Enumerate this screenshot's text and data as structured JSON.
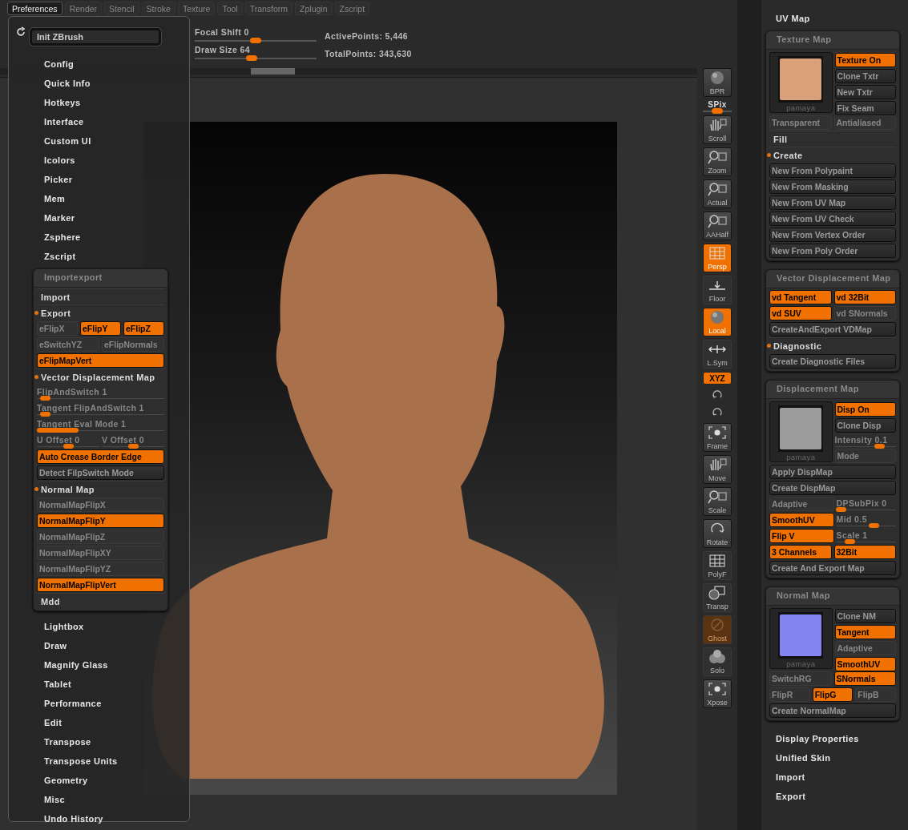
{
  "menu_bar": [
    {
      "label": "Preferences",
      "selected": true
    },
    {
      "label": "Render",
      "selected": false
    },
    {
      "label": "Stencil",
      "selected": false
    },
    {
      "label": "Stroke",
      "selected": false
    },
    {
      "label": "Texture",
      "selected": false
    },
    {
      "label": "Tool",
      "selected": false
    },
    {
      "label": "Transform",
      "selected": false
    },
    {
      "label": "Zplugin",
      "selected": false
    },
    {
      "label": "Zscript",
      "selected": false
    }
  ],
  "toolbar": {
    "focal_shift": {
      "label": "Focal Shift",
      "value": "0",
      "level": 0.5
    },
    "draw_size": {
      "label": "Draw Size",
      "value": "64",
      "level": 0.47
    },
    "stats": [
      {
        "label": "ActivePoints:",
        "value": "5,446"
      },
      {
        "label": "TotalPoints:",
        "value": "343,630"
      }
    ]
  },
  "columns": [
    {
      "kind": "menu",
      "init_button": "Init ZBrush",
      "items": [
        {
          "kind": "item",
          "label": "Config"
        },
        {
          "kind": "item",
          "label": "Quick Info"
        },
        {
          "kind": "item",
          "label": "Hotkeys"
        },
        {
          "kind": "item",
          "label": "Interface"
        },
        {
          "kind": "item",
          "label": "Custom UI"
        },
        {
          "kind": "item",
          "label": "Icolors"
        },
        {
          "kind": "item",
          "label": "Picker"
        },
        {
          "kind": "item",
          "label": "Mem"
        },
        {
          "kind": "item",
          "label": "Marker"
        },
        {
          "kind": "item",
          "label": "Zsphere"
        },
        {
          "kind": "item",
          "label": "Zscript"
        },
        {
          "kind": "panel",
          "title": "Importexport",
          "rows": [
            {
              "kind": "section",
              "label": "Import",
              "expanded": false
            },
            {
              "kind": "section",
              "label": "Export",
              "expanded": true
            },
            {
              "kind": "buttons",
              "items": [
                {
                  "kind": "toggle",
                  "label": "eFlipX",
                  "on": false
                },
                {
                  "kind": "toggle",
                  "label": "eFlipY",
                  "on": true
                },
                {
                  "kind": "toggle",
                  "label": "eFlipZ",
                  "on": true
                }
              ]
            },
            {
              "kind": "buttons",
              "items": [
                {
                  "kind": "toggle",
                  "label": "eSwitchYZ",
                  "on": false
                },
                {
                  "kind": "toggle",
                  "label": "eFlipNormals",
                  "on": false
                }
              ]
            },
            {
              "kind": "buttons",
              "items": [
                {
                  "kind": "toggle",
                  "label": "eFlipMapVert",
                  "on": true
                }
              ]
            },
            {
              "kind": "section",
              "label": "Vector Displacement Map",
              "expanded": true
            },
            {
              "kind": "buttons",
              "items": [
                {
                  "kind": "slider",
                  "label": "FlipAndSwitch",
                  "value": "1",
                  "level": 0.06
                }
              ]
            },
            {
              "kind": "buttons",
              "items": [
                {
                  "kind": "slider",
                  "label": "Tangent FlipAndSwitch",
                  "value": "1",
                  "level": 0.06
                }
              ]
            },
            {
              "kind": "buttons",
              "items": [
                {
                  "kind": "slider",
                  "label": "Tangent Eval Mode",
                  "value": "1",
                  "level": 0.33
                }
              ]
            },
            {
              "kind": "buttons",
              "items": [
                {
                  "kind": "slider",
                  "label": "U Offset",
                  "value": "0",
                  "level": 0.5
                },
                {
                  "kind": "slider",
                  "label": "V Offset",
                  "value": "0",
                  "level": 0.5
                }
              ]
            },
            {
              "kind": "buttons",
              "items": [
                {
                  "kind": "toggle",
                  "label": "Auto Crease Border Edge",
                  "on": true
                }
              ]
            },
            {
              "kind": "buttons",
              "items": [
                {
                  "kind": "action",
                  "label": "Detect FilpSwitch Mode"
                }
              ]
            },
            {
              "kind": "section",
              "label": "Normal Map",
              "expanded": true
            },
            {
              "kind": "buttons",
              "items": [
                {
                  "kind": "toggle",
                  "label": "NormalMapFlipX",
                  "on": false
                }
              ]
            },
            {
              "kind": "buttons",
              "items": [
                {
                  "kind": "toggle",
                  "label": "NormalMapFlipY",
                  "on": true
                }
              ]
            },
            {
              "kind": "buttons",
              "items": [
                {
                  "kind": "toggle",
                  "label": "NormalMapFlipZ",
                  "on": false
                }
              ]
            },
            {
              "kind": "buttons",
              "items": [
                {
                  "kind": "toggle",
                  "label": "NormalMapFlipXY",
                  "on": false
                }
              ]
            },
            {
              "kind": "buttons",
              "items": [
                {
                  "kind": "toggle",
                  "label": "NormalMapFlipYZ",
                  "on": false
                }
              ]
            },
            {
              "kind": "buttons",
              "items": [
                {
                  "kind": "toggle",
                  "label": "NormalMapFlipVert",
                  "on": true
                }
              ]
            },
            {
              "kind": "section",
              "label": "Mdd",
              "expanded": false
            }
          ]
        },
        {
          "kind": "item",
          "label": "Lightbox"
        },
        {
          "kind": "item",
          "label": "Draw"
        },
        {
          "kind": "item",
          "label": "Magnify Glass"
        },
        {
          "kind": "item",
          "label": "Tablet"
        },
        {
          "kind": "item",
          "label": "Performance"
        },
        {
          "kind": "item",
          "label": "Edit"
        },
        {
          "kind": "item",
          "label": "Transpose"
        },
        {
          "kind": "item",
          "label": "Transpose Units"
        },
        {
          "kind": "item",
          "label": "Geometry"
        },
        {
          "kind": "item",
          "label": "Misc"
        },
        {
          "kind": "item",
          "label": "Undo History"
        }
      ]
    },
    {
      "kind": "tray",
      "items": [
        {
          "kind": "item",
          "label": "UV Map"
        },
        {
          "kind": "panel",
          "title": "Texture Map",
          "rows": [
            {
              "kind": "thumb",
              "caption": "pamaya",
              "color": "#d9a07a",
              "items": [
                {
                  "kind": "toggle",
                  "label": "Texture On",
                  "on": true
                },
                {
                  "kind": "action",
                  "label": "Clone Txtr"
                },
                {
                  "kind": "action",
                  "label": "New Txtr"
                },
                {
                  "kind": "action",
                  "label": "Fix Seam"
                }
              ]
            },
            {
              "kind": "buttons",
              "items": [
                {
                  "kind": "toggle",
                  "label": "Transparent",
                  "on": false
                },
                {
                  "kind": "toggle",
                  "label": "Antialiased",
                  "on": false
                }
              ]
            },
            {
              "kind": "section",
              "label": "Fill",
              "expanded": false
            },
            {
              "kind": "section",
              "label": "Create",
              "expanded": true
            },
            {
              "kind": "buttons",
              "items": [
                {
                  "kind": "action",
                  "label": "New From Polypaint"
                }
              ]
            },
            {
              "kind": "buttons",
              "items": [
                {
                  "kind": "action",
                  "label": "New From Masking"
                }
              ]
            },
            {
              "kind": "buttons",
              "items": [
                {
                  "kind": "action",
                  "label": "New From UV Map"
                }
              ]
            },
            {
              "kind": "buttons",
              "items": [
                {
                  "kind": "action",
                  "label": "New From UV Check"
                }
              ]
            },
            {
              "kind": "buttons",
              "items": [
                {
                  "kind": "action",
                  "label": "New From Vertex Order"
                }
              ]
            },
            {
              "kind": "buttons",
              "items": [
                {
                  "kind": "action",
                  "label": "New From Poly Order"
                }
              ]
            }
          ]
        },
        {
          "kind": "panel",
          "title": "Vector Displacement Map",
          "rows": [
            {
              "kind": "buttons",
              "items": [
                {
                  "kind": "toggle",
                  "label": "vd Tangent",
                  "on": true
                },
                {
                  "kind": "toggle",
                  "label": "vd 32Bit",
                  "on": true
                }
              ]
            },
            {
              "kind": "buttons",
              "items": [
                {
                  "kind": "toggle",
                  "label": "vd SUV",
                  "on": true
                },
                {
                  "kind": "toggle",
                  "label": "vd SNormals",
                  "on": false
                }
              ]
            },
            {
              "kind": "buttons",
              "items": [
                {
                  "kind": "action",
                  "label": "CreateAndExport VDMap"
                }
              ]
            },
            {
              "kind": "section",
              "label": "Diagnostic",
              "expanded": true
            },
            {
              "kind": "buttons",
              "items": [
                {
                  "kind": "action",
                  "label": "Create Diagnostic Files"
                }
              ]
            }
          ]
        },
        {
          "kind": "panel",
          "title": "Displacement Map",
          "rows": [
            {
              "kind": "thumb",
              "caption": "pamaya",
              "color": "#9c9c9c",
              "items": [
                {
                  "kind": "toggle",
                  "label": "Disp On",
                  "on": true
                },
                {
                  "kind": "action",
                  "label": "Clone Disp"
                },
                {
                  "kind": "slider",
                  "label": "Intensity",
                  "value": "0.1",
                  "level": 0.72
                },
                {
                  "kind": "toggle",
                  "label": "Mode",
                  "on": false
                }
              ]
            },
            {
              "kind": "buttons",
              "items": [
                {
                  "kind": "action",
                  "label": "Apply DispMap"
                }
              ]
            },
            {
              "kind": "buttons",
              "items": [
                {
                  "kind": "action",
                  "label": "Create DispMap"
                }
              ]
            },
            {
              "kind": "buttons",
              "items": [
                {
                  "kind": "toggle",
                  "label": "Adaptive",
                  "on": false
                },
                {
                  "kind": "slider",
                  "label": "DPSubPix",
                  "value": "0",
                  "level": 0.08
                }
              ]
            },
            {
              "kind": "buttons",
              "items": [
                {
                  "kind": "toggle",
                  "label": "SmoothUV",
                  "on": true
                },
                {
                  "kind": "slider",
                  "label": "Mid",
                  "value": "0.5",
                  "level": 0.62
                }
              ]
            },
            {
              "kind": "buttons",
              "items": [
                {
                  "kind": "toggle",
                  "label": "Flip V",
                  "on": true
                },
                {
                  "kind": "slider",
                  "label": "Scale",
                  "value": "1",
                  "level": 0.22
                }
              ]
            },
            {
              "kind": "buttons",
              "items": [
                {
                  "kind": "toggle",
                  "label": "3 Channels",
                  "on": true
                },
                {
                  "kind": "toggle",
                  "label": "32Bit",
                  "on": true
                }
              ]
            },
            {
              "kind": "buttons",
              "items": [
                {
                  "kind": "action",
                  "label": "Create And Export Map"
                }
              ]
            }
          ]
        },
        {
          "kind": "panel",
          "title": "Normal Map",
          "rows": [
            {
              "kind": "thumb",
              "caption": "pamaya",
              "color": "#8585f2",
              "items": [
                {
                  "kind": "action",
                  "label": "Clone NM"
                },
                {
                  "kind": "toggle",
                  "label": "Tangent",
                  "on": true
                },
                {
                  "kind": "toggle",
                  "label": "Adaptive",
                  "on": false
                },
                {
                  "kind": "toggle",
                  "label": "SmoothUV",
                  "on": true
                }
              ]
            },
            {
              "kind": "buttons",
              "items": [
                {
                  "kind": "toggle",
                  "label": "SwitchRG",
                  "on": false
                },
                {
                  "kind": "toggle",
                  "label": "SNormals",
                  "on": true
                }
              ]
            },
            {
              "kind": "buttons",
              "items": [
                {
                  "kind": "toggle",
                  "label": "FlipR",
                  "on": false
                },
                {
                  "kind": "toggle",
                  "label": "FlipG",
                  "on": true
                },
                {
                  "kind": "toggle",
                  "label": "FlipB",
                  "on": false
                }
              ]
            },
            {
              "kind": "buttons",
              "items": [
                {
                  "kind": "action",
                  "label": "Create NormalMap"
                }
              ]
            }
          ]
        },
        {
          "kind": "item",
          "label": "Display Properties"
        },
        {
          "kind": "item",
          "label": "Unified Skin"
        },
        {
          "kind": "item",
          "label": "Import"
        },
        {
          "kind": "item",
          "label": "Export"
        }
      ]
    }
  ],
  "shelf": [
    {
      "kind": "action",
      "label": "BPR"
    },
    {
      "kind": "slider",
      "label": "SPix",
      "level": 0.5
    },
    {
      "kind": "action",
      "label": "Scroll"
    },
    {
      "kind": "action",
      "label": "Zoom"
    },
    {
      "kind": "action",
      "label": "Actual"
    },
    {
      "kind": "action",
      "label": "AAHalf"
    },
    {
      "kind": "toggle",
      "label": "Persp",
      "on": true,
      "disabled": false
    },
    {
      "kind": "toggle",
      "label": "Floor",
      "on": false,
      "disabled": false
    },
    {
      "kind": "toggle",
      "label": "Local",
      "on": true,
      "disabled": false
    },
    {
      "kind": "toggle",
      "label": "L.Sym",
      "on": false,
      "disabled": false
    },
    {
      "kind": "axis",
      "label": "XYZ",
      "on": true
    },
    {
      "kind": "icon"
    },
    {
      "kind": "icon"
    },
    {
      "kind": "action",
      "label": "Frame"
    },
    {
      "kind": "action",
      "label": "Move"
    },
    {
      "kind": "action",
      "label": "Scale"
    },
    {
      "kind": "action",
      "label": "Rotate"
    },
    {
      "kind": "toggle",
      "label": "PolyF",
      "on": false,
      "disabled": false
    },
    {
      "kind": "toggle",
      "label": "Transp",
      "on": false,
      "disabled": false
    },
    {
      "kind": "toggle",
      "label": "Ghost",
      "on": false,
      "disabled": true
    },
    {
      "kind": "toggle",
      "label": "Solo",
      "on": false,
      "disabled": false
    },
    {
      "kind": "action",
      "label": "Xpose"
    }
  ]
}
